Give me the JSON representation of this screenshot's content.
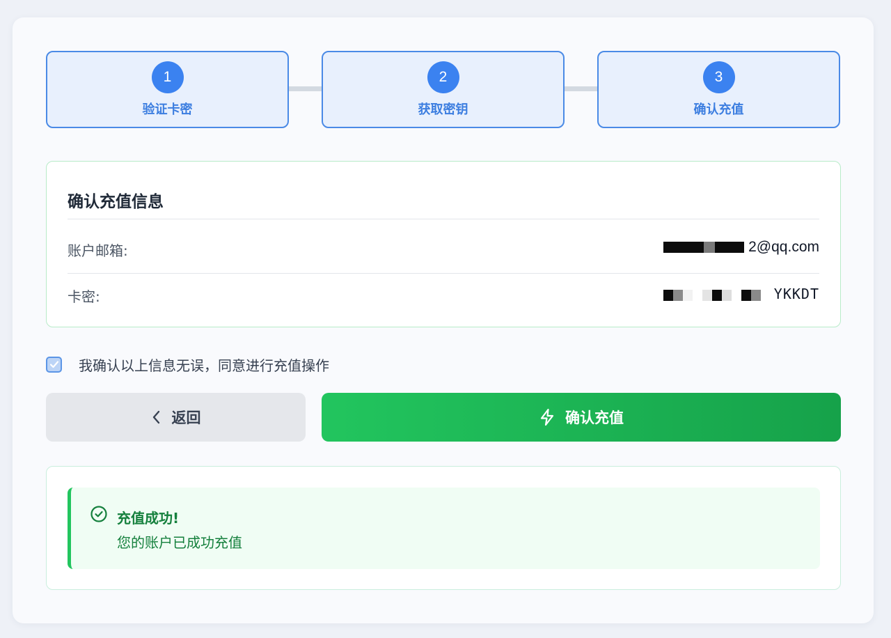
{
  "steps": [
    {
      "number": "1",
      "label": "验证卡密"
    },
    {
      "number": "2",
      "label": "获取密钥"
    },
    {
      "number": "3",
      "label": "确认充值"
    }
  ],
  "info": {
    "title": "确认充值信息",
    "email_label": "账户邮箱:",
    "email_value": "2@qq.com",
    "card_label": "卡密:",
    "card_value": "YKKDT"
  },
  "agreement": {
    "checked": true,
    "text": "我确认以上信息无误，同意进行充值操作"
  },
  "buttons": {
    "back_label": "返回",
    "confirm_label": "确认充值"
  },
  "success": {
    "title": "充值成功!",
    "message": "您的账户已成功充值"
  },
  "colors": {
    "accent": "#3b82f0",
    "success": "#22c55e",
    "success_text": "#15803d"
  },
  "icons": {
    "back": "chevron-left-icon",
    "confirm": "lightning-icon",
    "success": "check-circle-icon",
    "checkbox": "check-icon"
  }
}
